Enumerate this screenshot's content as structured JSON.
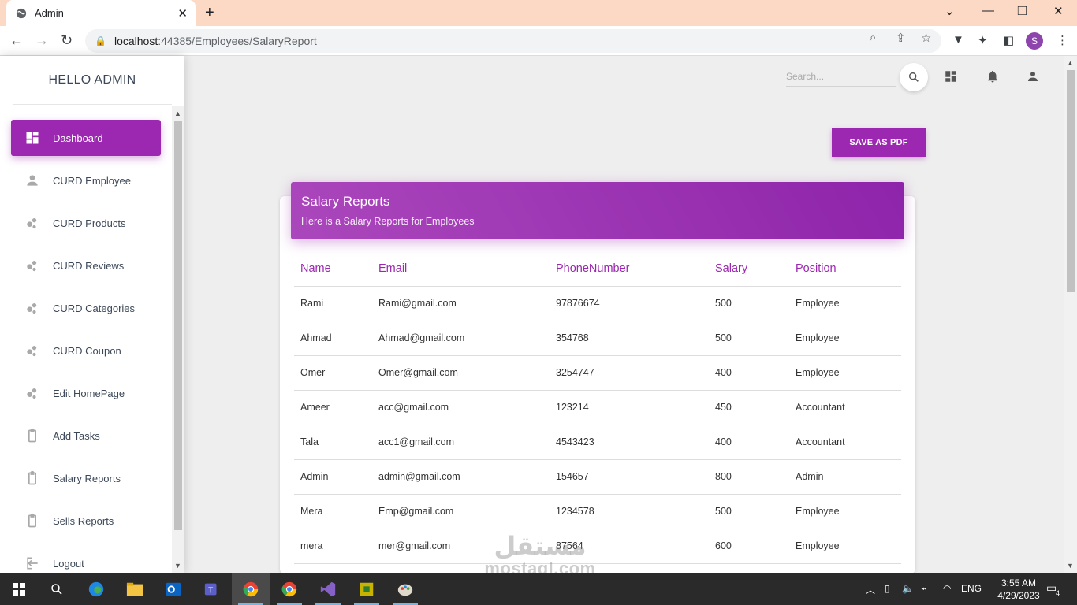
{
  "browser": {
    "tab_title": "Admin",
    "url_host": "localhost",
    "url_path": ":44385/Employees/SalaryReport",
    "profile_initial": "S"
  },
  "sidebar": {
    "brand": "HELLO ADMIN",
    "items": [
      {
        "label": "Dashboard",
        "icon": "dashboard-icon",
        "active": true
      },
      {
        "label": "CURD Employee",
        "icon": "person-icon"
      },
      {
        "label": "CURD Products",
        "icon": "bubble-chart-icon"
      },
      {
        "label": "CURD Reviews",
        "icon": "bubble-chart-icon"
      },
      {
        "label": "CURD Categories",
        "icon": "bubble-chart-icon"
      },
      {
        "label": "CURD Coupon",
        "icon": "bubble-chart-icon"
      },
      {
        "label": "Edit HomePage",
        "icon": "bubble-chart-icon"
      },
      {
        "label": "Add Tasks",
        "icon": "clipboard-icon"
      },
      {
        "label": "Salary Reports",
        "icon": "clipboard-icon"
      },
      {
        "label": "Sells Reports",
        "icon": "clipboard-icon"
      },
      {
        "label": "Logout",
        "icon": "logout-icon"
      }
    ]
  },
  "topbar": {
    "search_placeholder": "Search..."
  },
  "actions": {
    "save_pdf": "SAVE AS PDF"
  },
  "report": {
    "title": "Salary Reports",
    "subtitle": "Here is a Salary Reports for Employees",
    "columns": [
      "Name",
      "Email",
      "PhoneNumber",
      "Salary",
      "Position"
    ],
    "rows": [
      [
        "Rami",
        "Rami@gmail.com",
        "97876674",
        "500",
        "Employee"
      ],
      [
        "Ahmad",
        "Ahmad@gmail.com",
        "354768",
        "500",
        "Employee"
      ],
      [
        "Omer",
        "Omer@gmail.com",
        "3254747",
        "400",
        "Employee"
      ],
      [
        "Ameer",
        "acc@gmail.com",
        "123214",
        "450",
        "Accountant"
      ],
      [
        "Tala",
        "acc1@gmail.com",
        "4543423",
        "400",
        "Accountant"
      ],
      [
        "Admin",
        "admin@gmail.com",
        "154657",
        "800",
        "Admin"
      ],
      [
        "Mera",
        "Emp@gmail.com",
        "1234578",
        "500",
        "Employee"
      ],
      [
        "mera",
        "mer@gmail.com",
        "87564",
        "600",
        "Employee"
      ]
    ]
  },
  "watermark": {
    "arabic": "مستقل",
    "latin": "mostaql.com"
  },
  "taskbar": {
    "language": "ENG",
    "time": "3:55 AM",
    "date": "4/29/2023",
    "notifications": "4"
  }
}
